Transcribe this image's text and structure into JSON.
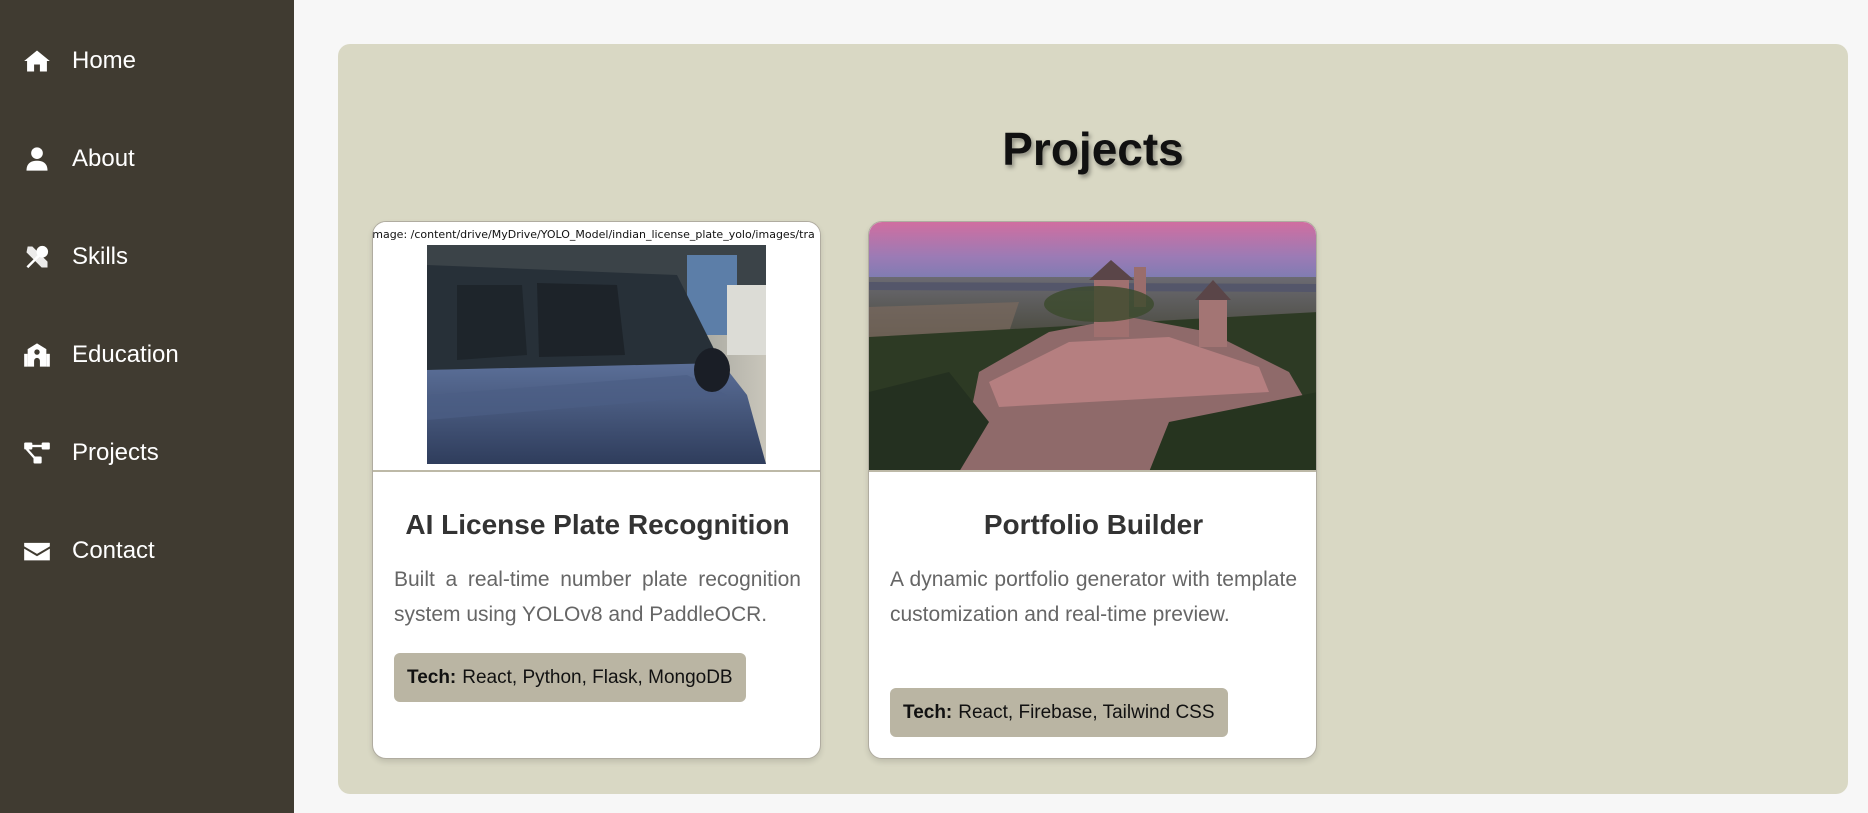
{
  "sidebar": {
    "items": [
      {
        "label": "Home",
        "icon": "home-icon"
      },
      {
        "label": "About",
        "icon": "user-icon"
      },
      {
        "label": "Skills",
        "icon": "tools-icon"
      },
      {
        "label": "Education",
        "icon": "school-icon"
      },
      {
        "label": "Projects",
        "icon": "project-diagram-icon"
      },
      {
        "label": "Contact",
        "icon": "envelope-icon"
      }
    ]
  },
  "main": {
    "title": "Projects",
    "projects": [
      {
        "image_caption": "Image: /content/drive/MyDrive/YOLO_Model/indian_license_plate_yolo/images/tra",
        "title": "AI License Plate Recognition",
        "description": "Built a real-time number plate recognition system using YOLOv8 and PaddleOCR.",
        "tech_label": "Tech:",
        "tech": "React, Python, Flask, MongoDB"
      },
      {
        "title": "Portfolio Builder",
        "description": "A dynamic portfolio generator with template customization and real-time preview.",
        "tech_label": "Tech:",
        "tech": "React, Firebase, Tailwind CSS"
      }
    ]
  },
  "colors": {
    "sidebar_bg": "#403b31",
    "panel_bg": "#d9d8c4",
    "badge_bg": "#bab5a3"
  }
}
